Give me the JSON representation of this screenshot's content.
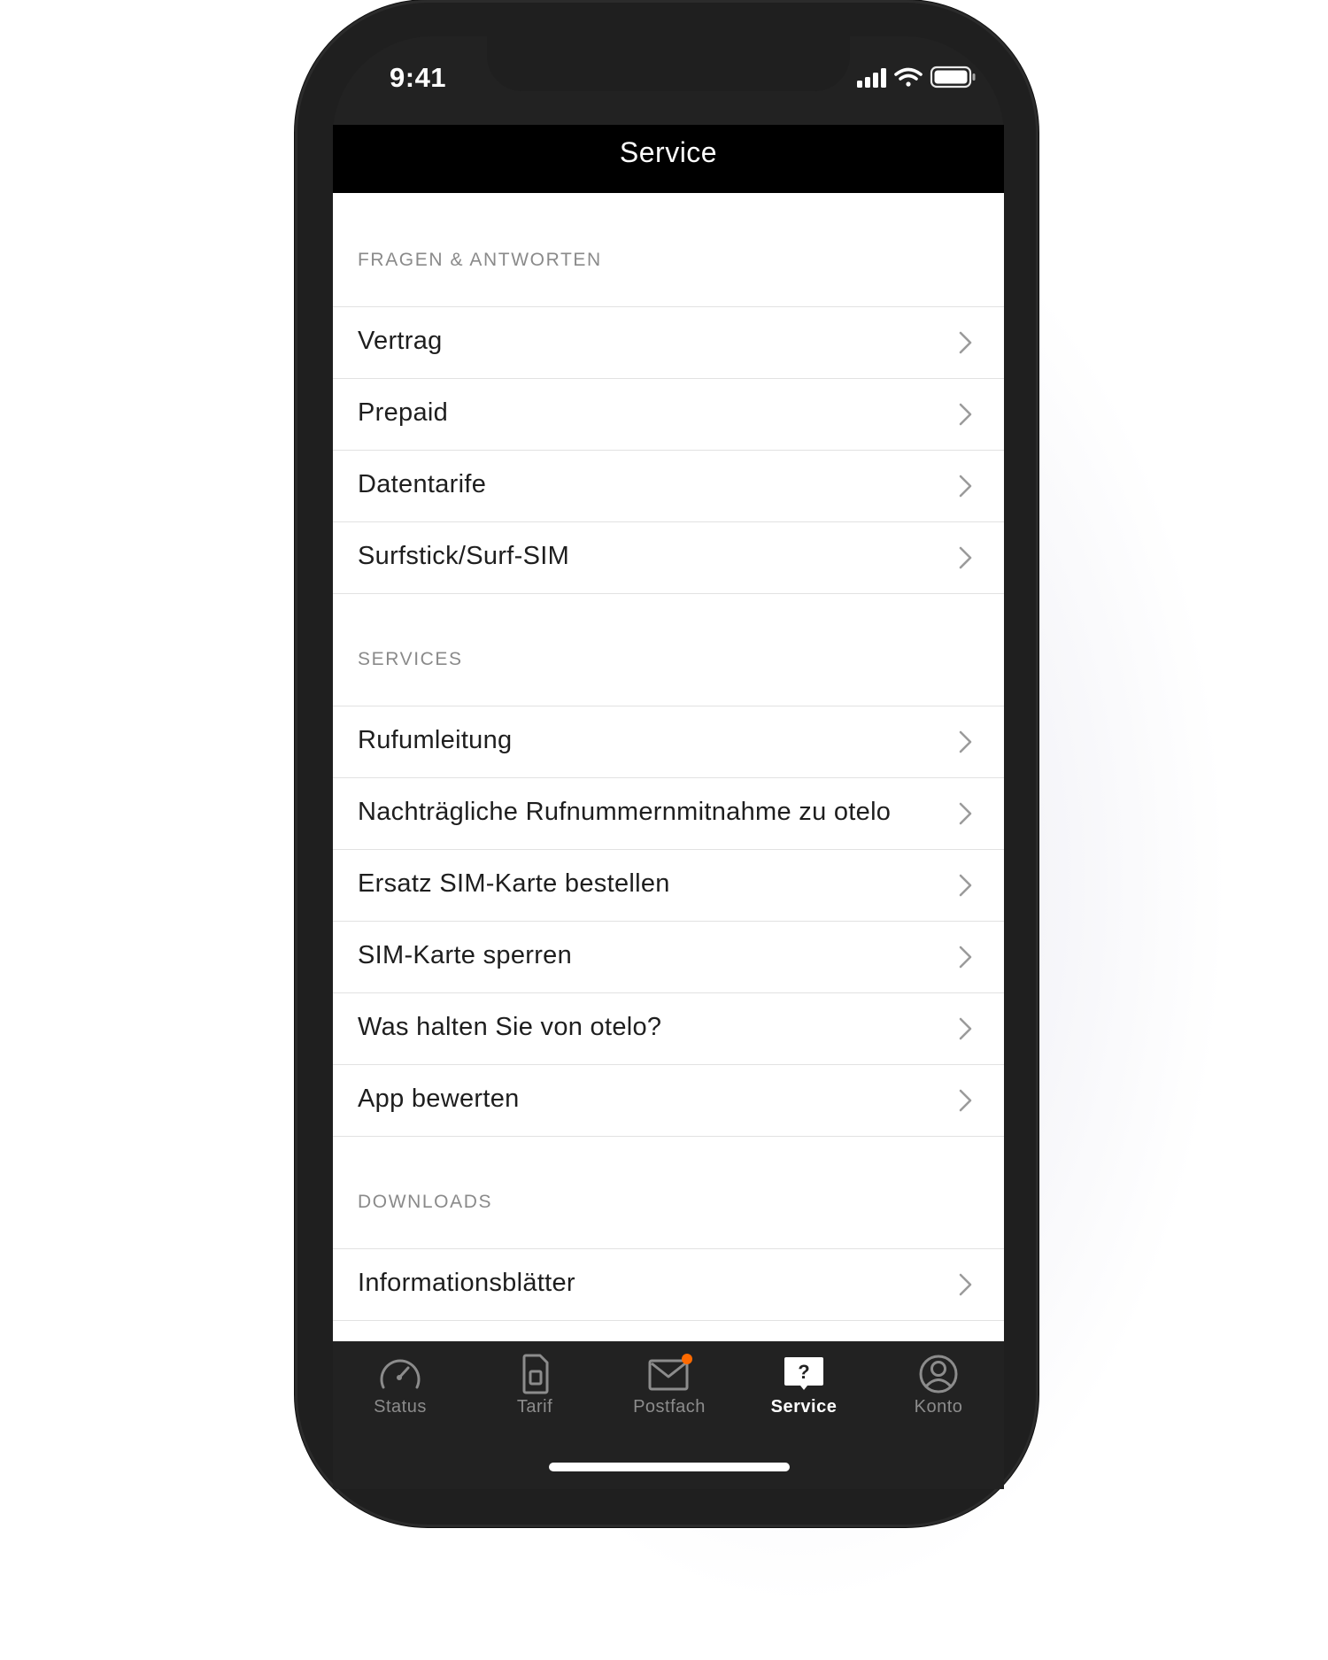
{
  "status_bar": {
    "time": "9:41"
  },
  "nav": {
    "title": "Service"
  },
  "sections": {
    "faq": {
      "header": "FRAGEN & ANTWORTEN",
      "items": [
        "Vertrag",
        "Prepaid",
        "Datentarife",
        "Surfstick/Surf-SIM"
      ]
    },
    "services": {
      "header": "SERVICES",
      "items": [
        "Rufumleitung",
        "Nachträgliche Rufnummernmitnahme zu otelo",
        "Ersatz SIM-Karte bestellen",
        "SIM-Karte sperren",
        "Was halten Sie von otelo?",
        "App bewerten"
      ]
    },
    "downloads": {
      "header": "DOWNLOADS",
      "items": [
        "Informationsblätter"
      ]
    }
  },
  "tabbar": {
    "tabs": [
      {
        "label": "Status",
        "icon": "speedometer-icon"
      },
      {
        "label": "Tarif",
        "icon": "sim-card-icon"
      },
      {
        "label": "Postfach",
        "icon": "mail-icon"
      },
      {
        "label": "Service",
        "icon": "help-icon"
      },
      {
        "label": "Konto",
        "icon": "account-icon"
      }
    ],
    "active": "Service",
    "badge_color": "#ff6a00"
  }
}
